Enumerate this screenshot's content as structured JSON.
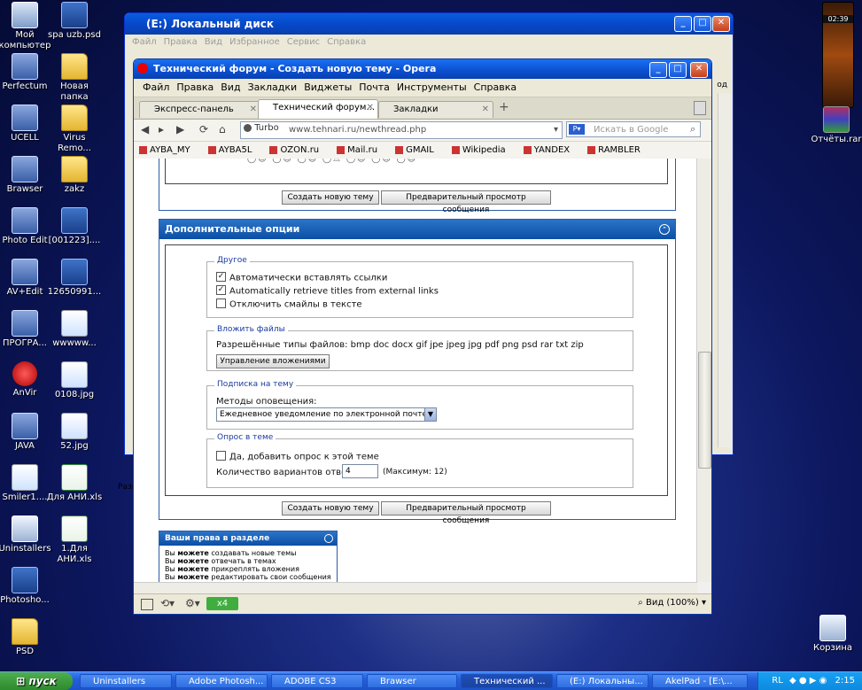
{
  "desktop": {
    "icons_left": [
      {
        "label": "Мой компьютер",
        "kind": "pc",
        "icon": "computer-icon"
      },
      {
        "label": "Perfectum",
        "kind": "app",
        "icon": "app-icon"
      },
      {
        "label": "UCELL",
        "kind": "app",
        "icon": "app-icon"
      },
      {
        "label": "Brawser",
        "kind": "app",
        "icon": "globe-icon"
      },
      {
        "label": "Photo Edit",
        "kind": "app",
        "icon": "app-icon"
      },
      {
        "label": "AV+Edit",
        "kind": "app",
        "icon": "app-icon"
      },
      {
        "label": "ПРОГРА...",
        "kind": "app",
        "icon": "app-icon"
      },
      {
        "label": "AnVir",
        "kind": "red",
        "icon": "app-icon"
      },
      {
        "label": "JAVA",
        "kind": "app",
        "icon": "app-icon"
      },
      {
        "label": "Smiler1....",
        "kind": "img",
        "icon": "image-icon"
      },
      {
        "label": "Uninstallers",
        "kind": "bin",
        "icon": "app-icon"
      },
      {
        "label": "Photosho...",
        "kind": "psd",
        "icon": "photoshop-icon"
      },
      {
        "label": "PSD",
        "kind": "folder",
        "icon": "folder-icon"
      }
    ],
    "icons_col2": [
      {
        "label": "spa uzb.psd",
        "kind": "psd",
        "icon": "psd-file-icon"
      },
      {
        "label": "Новая папка",
        "kind": "folder",
        "icon": "folder-icon"
      },
      {
        "label": "Virus Remo...",
        "kind": "folder",
        "icon": "folder-icon"
      },
      {
        "label": "zakz",
        "kind": "folder",
        "icon": "folder-icon"
      },
      {
        "label": "[001223]....",
        "kind": "psd",
        "icon": "psd-file-icon"
      },
      {
        "label": "12650991...",
        "kind": "psd",
        "icon": "psd-file-icon"
      },
      {
        "label": "wwwww...",
        "kind": "img",
        "icon": "image-icon"
      },
      {
        "label": "0108.jpg",
        "kind": "img",
        "icon": "image-icon"
      },
      {
        "label": "52.jpg",
        "kind": "img",
        "icon": "image-icon"
      },
      {
        "label": "Для АНИ.xls",
        "kind": "xls",
        "icon": "excel-icon"
      },
      {
        "label": "1.Для АНИ.xls",
        "kind": "xls",
        "icon": "excel-icon"
      }
    ],
    "icons_right": [
      {
        "label": "Отчёты.rar",
        "kind": "img",
        "icon": "archive-icon"
      },
      {
        "label": "Корзина",
        "kind": "bin",
        "icon": "recycle-bin-icon"
      }
    ],
    "gadget_time": "02:39"
  },
  "explorer": {
    "title": "(E:) Локальный диск",
    "menu": [
      "Файл",
      "Правка",
      "Вид",
      "Избранное",
      "Сервис",
      "Справка"
    ],
    "side_text": "Разм",
    "side_text2": "од"
  },
  "opera": {
    "title": "Технический форум - Создать новую тему - Opera",
    "menu": [
      "Файл",
      "Правка",
      "Вид",
      "Закладки",
      "Виджеты",
      "Почта",
      "Инструменты",
      "Справка"
    ],
    "tabs": [
      "Экспресс-панель",
      "Технический форум...",
      "Закладки"
    ],
    "turbo_label": "Turbo",
    "url": "www.tehnari.ru/newthread.php",
    "search_placeholder": "Искать в Google",
    "bookmarks": [
      "AYBA_MY",
      "AYBA5L",
      "OZON.ru",
      "Mail.ru",
      "GMAIL",
      "Wikipedia",
      "YANDEX",
      "RAMBLER"
    ],
    "status": {
      "speed": "x4",
      "zoom": "Вид (100%)"
    }
  },
  "forum": {
    "buttons": {
      "create": "Создать новую тему",
      "preview": "Предварительный просмотр сообщения"
    },
    "extra_options_title": "Дополнительные опции",
    "other_legend": "Другое",
    "opt_autolinks": "Автоматически вставлять ссылки",
    "opt_titles": "Automatically retrieve titles from external links",
    "opt_nosmiles": "Отключить смайлы в тексте",
    "attach_legend": "Вложить файлы",
    "attach_types": "Разрешённые типы файлов: bmp doc docx gif jpe jpeg jpg pdf png psd rar txt zip",
    "attach_button": "Управление вложениями",
    "subscribe_legend": "Подписка на тему",
    "notify_label": "Методы оповещения:",
    "notify_value": "Ежедневное уведомление по электронной почте",
    "poll_legend": "Опрос в теме",
    "poll_add": "Да, добавить опрос к этой теме",
    "poll_count_label": "Количество вариантов ответов:",
    "poll_count_value": "4",
    "poll_max": "(Максимум: 12)",
    "rights_title": "Ваши права в разделе",
    "rights": [
      {
        "pre": "Вы ",
        "bold": "можете",
        "post": " создавать новые темы"
      },
      {
        "pre": "Вы ",
        "bold": "можете",
        "post": " отвечать в темах"
      },
      {
        "pre": "Вы ",
        "bold": "можете",
        "post": " прикреплять вложения"
      },
      {
        "pre": "Вы ",
        "bold": "можете",
        "post": " редактировать свои сообщения"
      }
    ]
  },
  "taskbar": {
    "start_label": "пуск",
    "tasks": [
      "Uninstallers",
      "Adobe Photosh...",
      "ADOBE CS3",
      "Brawser",
      "Технический ...",
      "(E:) Локальны...",
      "AkelPad - [E:\\..."
    ],
    "lang": "RL",
    "clock": "2:15"
  },
  "colors": {
    "panel_header": "#0b4fa5",
    "xp_blue": "#245fdb",
    "start_green": "#2d8a2d"
  }
}
